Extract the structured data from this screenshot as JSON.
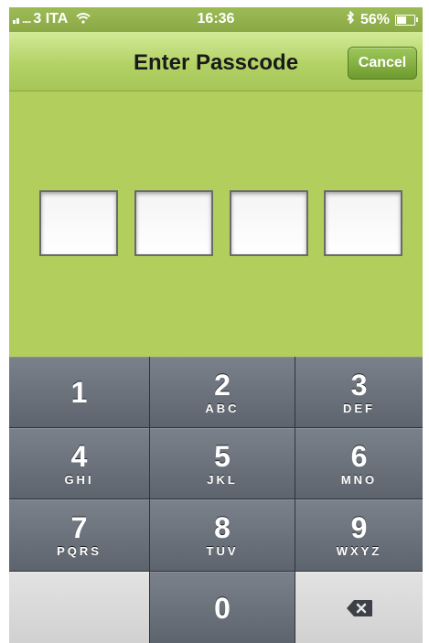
{
  "status_bar": {
    "carrier": "3 ITA",
    "time": "16:36",
    "battery": "56%",
    "battery_level": 0.56,
    "icons": [
      "signal-icon",
      "wifi-icon",
      "bluetooth-icon",
      "battery-icon"
    ]
  },
  "navbar": {
    "title": "Enter Passcode",
    "cancel_label": "Cancel"
  },
  "passcode": {
    "digit_count": 4,
    "entered": 0
  },
  "keypad": {
    "keys": [
      {
        "num": "1",
        "letters": ""
      },
      {
        "num": "2",
        "letters": "ABC"
      },
      {
        "num": "3",
        "letters": "DEF"
      },
      {
        "num": "4",
        "letters": "GHI"
      },
      {
        "num": "5",
        "letters": "JKL"
      },
      {
        "num": "6",
        "letters": "MNO"
      },
      {
        "num": "7",
        "letters": "PQRS"
      },
      {
        "num": "8",
        "letters": "TUV"
      },
      {
        "num": "9",
        "letters": "WXYZ"
      },
      {
        "num": "0",
        "letters": ""
      }
    ],
    "delete_icon": "backspace-icon"
  },
  "colors": {
    "accent_green": "#b2cf5e",
    "key_dark": "#5d646d",
    "key_light": "#d1d1d1"
  }
}
